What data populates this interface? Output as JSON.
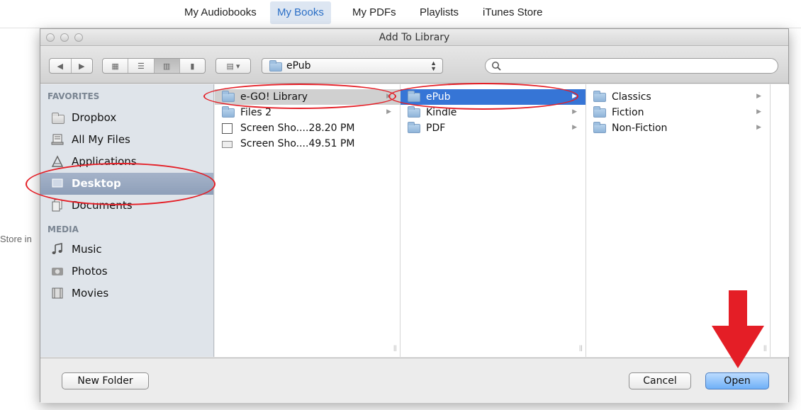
{
  "top_tabs": [
    {
      "label": "My Audiobooks",
      "active": false
    },
    {
      "label": "My Books",
      "active": true
    },
    {
      "label": "My PDFs",
      "active": false
    },
    {
      "label": "Playlists",
      "active": false
    },
    {
      "label": "iTunes Store",
      "active": false
    }
  ],
  "background_text": "Store in",
  "dialog": {
    "title": "Add To Library",
    "path_popup": "ePub",
    "search_placeholder": ""
  },
  "sidebar": {
    "favorites_header": "FAVORITES",
    "favorites": [
      {
        "label": "Dropbox",
        "icon": "folder-icon"
      },
      {
        "label": "All My Files",
        "icon": "all-files-icon"
      },
      {
        "label": "Applications",
        "icon": "applications-icon"
      },
      {
        "label": "Desktop",
        "icon": "desktop-icon",
        "selected": true
      },
      {
        "label": "Documents",
        "icon": "documents-icon"
      }
    ],
    "media_header": "MEDIA",
    "media": [
      {
        "label": "Music",
        "icon": "music-icon"
      },
      {
        "label": "Photos",
        "icon": "camera-icon"
      },
      {
        "label": "Movies",
        "icon": "film-icon"
      }
    ]
  },
  "columns": {
    "col1": [
      {
        "label": "e-GO! Library",
        "type": "folder",
        "has_children": true,
        "highlight": "grey"
      },
      {
        "label": "Files 2",
        "type": "folder",
        "has_children": true
      },
      {
        "label": "Screen Sho....28.20 PM",
        "type": "image"
      },
      {
        "label": "Screen Sho....49.51 PM",
        "type": "image-wide"
      }
    ],
    "col2": [
      {
        "label": "ePub",
        "type": "folder",
        "has_children": true,
        "highlight": "blue"
      },
      {
        "label": "Kindle",
        "type": "folder",
        "has_children": true
      },
      {
        "label": "PDF",
        "type": "folder",
        "has_children": true
      }
    ],
    "col3": [
      {
        "label": "Classics",
        "type": "folder",
        "has_children": true
      },
      {
        "label": "Fiction",
        "type": "folder",
        "has_children": true
      },
      {
        "label": "Non-Fiction",
        "type": "folder",
        "has_children": true
      }
    ]
  },
  "buttons": {
    "new_folder": "New Folder",
    "cancel": "Cancel",
    "open": "Open"
  },
  "colors": {
    "annotation": "#e41e26",
    "selection_blue": "#3675d6"
  }
}
